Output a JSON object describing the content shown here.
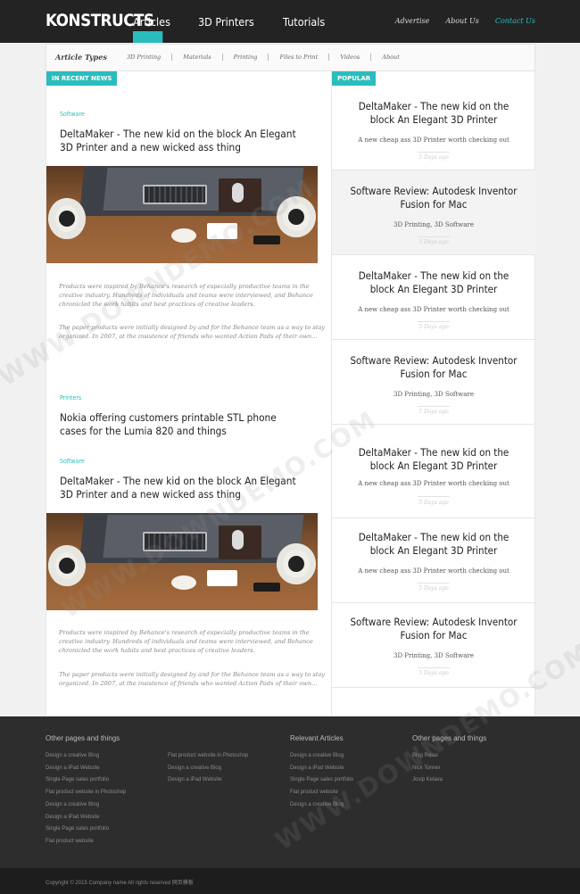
{
  "brand": {
    "logo": "KONSTRUCTS"
  },
  "mainnav": [
    {
      "label": "Articles",
      "active": true
    },
    {
      "label": "3D Printers"
    },
    {
      "label": "Tutorials"
    }
  ],
  "topright": [
    {
      "label": "Advertise"
    },
    {
      "label": "About Us"
    },
    {
      "label": "Contact Us",
      "accent": true
    }
  ],
  "types": {
    "label": "Article Types",
    "links": [
      "3D Printing",
      "Materials",
      "Printing",
      "Files to Print",
      "Videos",
      "About"
    ]
  },
  "recent": {
    "badge": "IN RECENT NEWS",
    "articles": [
      {
        "category": "Software",
        "title": "DeltaMaker - The new kid on the block An Elegant 3D Printer and a new wicked ass thing",
        "p1": "Products were inspired by Behance's research of especially productive teams in the creative industry. Hundreds of individuals and teams were interviewed, and Behance chronicled the work habits and best practices of creative leaders.",
        "p2": "The paper products were initially designed by and for the Behance team as a way to stay organized. In 2007, at the insistence of friends who wanted Action Pads of their own..."
      },
      {
        "category": "Printers",
        "title": "Nokia offering customers printable STL phone cases for the Lumia 820 and things"
      },
      {
        "category": "Software",
        "title": "DeltaMaker - The new kid on the block An Elegant 3D Printer and a new wicked ass thing",
        "p1": "Products were inspired by Behance's research of especially productive teams in the creative industry. Hundreds of individuals and teams were interviewed, and Behance chronicled the work habits and best practices of creative leaders.",
        "p2": "The paper products were initially designed by and for the Behance team as a way to stay organized. In 2007, at the insistence of friends who wanted Action Pads of their own..."
      }
    ]
  },
  "popular": {
    "badge": "POPULAR",
    "items": [
      {
        "title": "DeltaMaker - The new kid on the block An Elegant 3D Printer",
        "desc": "A new cheap ass 3D Printer worth checking out",
        "date": "5 Days ago"
      },
      {
        "title": "Software Review: Autodesk Inventor Fusion for Mac",
        "desc": "3D Printing, 3D Software",
        "date": "5 Days ago"
      },
      {
        "title": "DeltaMaker - The new kid on the block An Elegant 3D Printer",
        "desc": "A new cheap ass 3D Printer worth checking out",
        "date": "5 Days ago"
      },
      {
        "title": "Software Review: Autodesk Inventor Fusion for Mac",
        "desc": "3D Printing, 3D Software",
        "date": "5 Days ago"
      },
      {
        "title": "DeltaMaker - The new kid on the block An Elegant 3D Printer",
        "desc": "A new cheap ass 3D Printer worth checking out",
        "date": "5 Days ago"
      },
      {
        "title": "DeltaMaker - The new kid on the block An Elegant 3D Printer",
        "desc": "A new cheap ass 3D Printer worth checking out",
        "date": "5 Days ago"
      },
      {
        "title": "Software Review: Autodesk Inventor Fusion for Mac",
        "desc": "3D Printing, 3D Software",
        "date": "5 Days ago"
      }
    ]
  },
  "footer": {
    "col1": {
      "heading": "Other pages and things",
      "links": [
        "Design a creative Blog",
        "Design a iPad Website",
        "Single Page sales portfolio",
        "Flat product website in Photoshop",
        "Design a creative Blog",
        "Design a iPad Website",
        "Single Page sales portfolio",
        "Flat product website"
      ]
    },
    "col2": {
      "links": [
        "Flat product website in Photoshop",
        "Design a creative Blog",
        "Design a iPad Website"
      ]
    },
    "col3": {
      "heading": "Relevant Articles",
      "links": [
        "Design a creative Blog",
        "Design a iPad Website",
        "Single Page sales portfolio",
        "Flat product website",
        "Design a creative Blog"
      ]
    },
    "col4": {
      "heading": "Other pages and things",
      "links": [
        "Blog Relax",
        "Nick Tonner",
        "Josip Kelava"
      ]
    },
    "copyright": "Copyright © 2015 Company name All rights reserved 网页模板"
  },
  "watermark": "WWW.DOWNDEMO.COM"
}
